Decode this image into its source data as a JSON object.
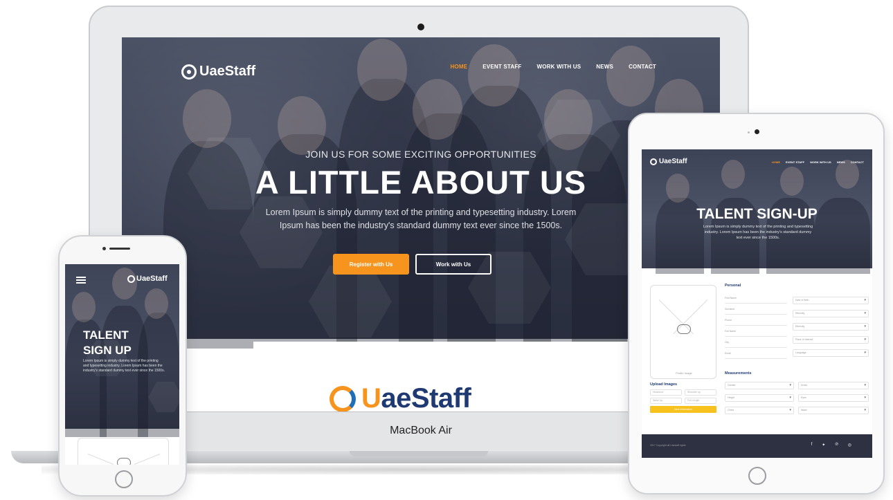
{
  "colors": {
    "accent": "#f7941d",
    "brand_dark": "#1f3a72",
    "brand_blue": "#1f6fb8",
    "hero_overlay": "#3f4558",
    "footer": "#2d3142"
  },
  "laptop": {
    "device_label": "MacBook Air",
    "site": {
      "logo_text": "UaeStaff",
      "nav": [
        {
          "label": "HOME",
          "active": true
        },
        {
          "label": "EVENT STAFF",
          "active": false
        },
        {
          "label": "WORK WITH US",
          "active": false
        },
        {
          "label": "NEWS",
          "active": false
        },
        {
          "label": "CONTACT",
          "active": false
        }
      ],
      "hero": {
        "kicker": "JOIN US FOR SOME EXCITING OPPORTUNITIES",
        "title": "A LITTLE ABOUT US",
        "text": "Lorem Ipsum is simply dummy text of the printing and typesetting industry. Lorem Ipsum has been the industry's standard dummy text ever since the 1500s.",
        "primary_button": "Register with Us",
        "secondary_button": "Work with Us"
      },
      "section_logo": {
        "u": "U",
        "rest": "aeStaff"
      }
    }
  },
  "tablet": {
    "logo_text": "UaeStaff",
    "nav": [
      {
        "label": "HOME",
        "active": true
      },
      {
        "label": "EVENT STAFF",
        "active": false
      },
      {
        "label": "WORK WITH US",
        "active": false
      },
      {
        "label": "NEWS",
        "active": false
      },
      {
        "label": "CONTACT",
        "active": false
      }
    ],
    "hero": {
      "title": "TALENT SIGN-UP",
      "text": "Lorem Ipsum is simply dummy text of the printing and typesetting industry. Lorem Ipsum has been the industry's standard dummy text ever since the 1500s."
    },
    "upload": {
      "caption": "Profile Image",
      "heading": "Upload Images",
      "fields": [
        "Headshot",
        "Shoulder up",
        "Waist Up",
        "Full Length"
      ],
      "button": "Next Information"
    },
    "personal": {
      "heading": "Personal",
      "left_fields": [
        "First Name",
        "Surname",
        "Phone",
        "Full Name",
        "City",
        "Email"
      ],
      "right_selects": [
        "Date of Birth",
        "Ethnicity",
        "Ethnicity",
        "Place of Interest",
        "Language"
      ]
    },
    "measurements": {
      "heading": "Measurements",
      "selects": [
        "Gender",
        "Dress",
        "Height",
        "Eyes",
        "Chest",
        "Waist"
      ]
    },
    "footer": {
      "copyright": "2017 Copyright all Uaestaff rights",
      "social": [
        {
          "icon": "facebook-icon",
          "glyph": "f"
        },
        {
          "icon": "twitter-icon",
          "glyph": "✦"
        },
        {
          "icon": "pinterest-icon",
          "glyph": "℗"
        },
        {
          "icon": "instagram-icon",
          "glyph": "◎"
        }
      ]
    }
  },
  "phone": {
    "logo_text": "UaeStaff",
    "hero": {
      "title_line1": "TALENT",
      "title_line2": "SIGN UP",
      "text": "Lorem Ipsum is simply dummy text of the printing and typesetting industry. Lorem Ipsum has been the industry's standard dummy text ever since the 1500s."
    }
  }
}
